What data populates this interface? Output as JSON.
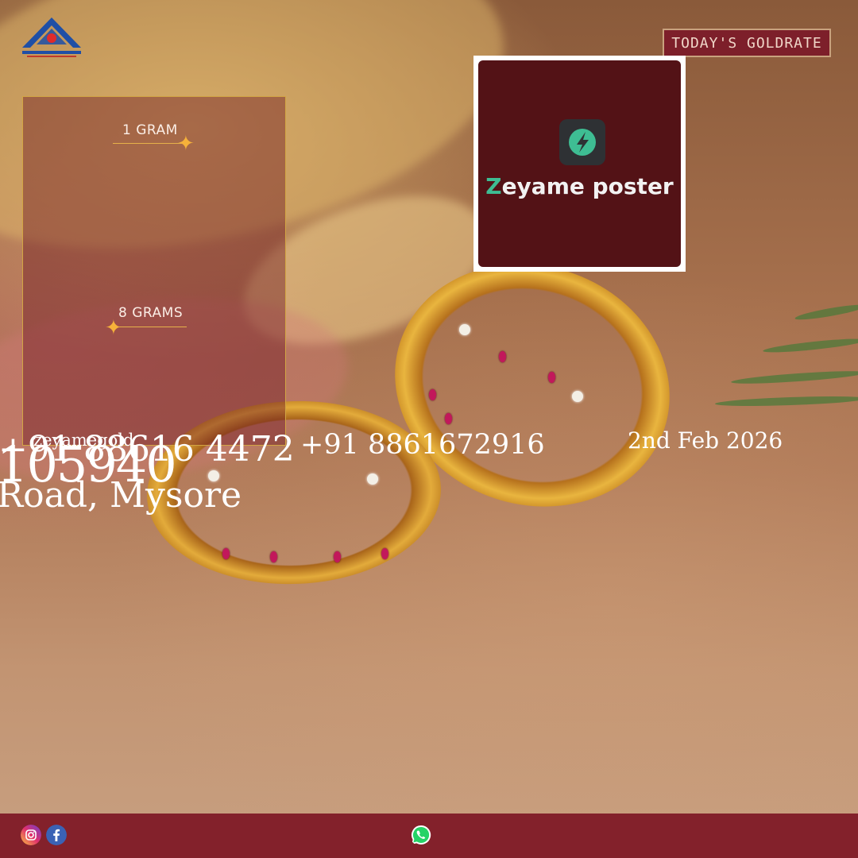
{
  "header": {
    "badge_label": "TODAY'S GOLDRATE"
  },
  "promo": {
    "brand_prefix": "Z",
    "brand_rest": "eyame poster"
  },
  "rates": {
    "items": [
      {
        "label": "1 GRAM"
      },
      {
        "label": "8 GRAMS"
      }
    ]
  },
  "contact": {
    "brand_name": "zeyamegold",
    "phone1": "+91 88616 4472",
    "phone2": "+91 8861672916",
    "rate_value": "105940",
    "address": "Road, Mysore",
    "date": "2nd Feb 2026"
  },
  "footer": {
    "icons": [
      "instagram-icon",
      "facebook-icon",
      "whatsapp-icon"
    ]
  },
  "colors": {
    "maroon": "#83212b",
    "gold": "#d2a544",
    "sparkle": "#f6b23a",
    "badge_border": "#c9a27e",
    "poster_green": "#3ebd93"
  }
}
